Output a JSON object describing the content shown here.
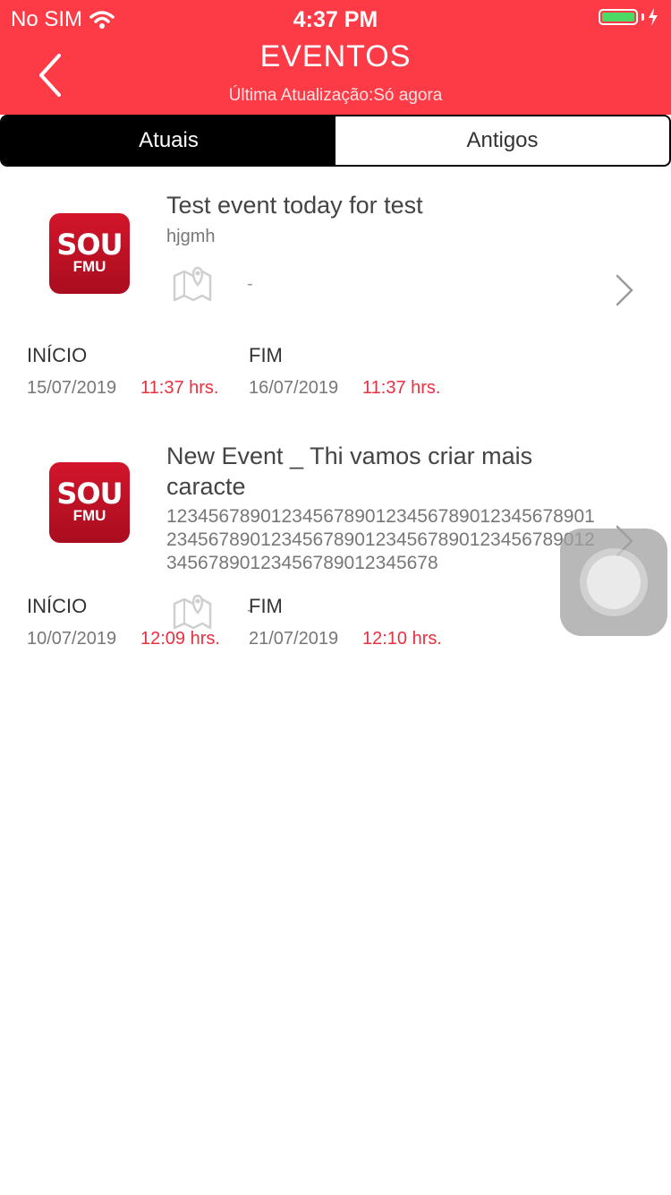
{
  "status_bar": {
    "carrier": "No SIM",
    "time": "4:37 PM",
    "battery_level": 1.0
  },
  "header": {
    "title": "EVENTOS",
    "subtitle": "Última Atualização:Só agora"
  },
  "tabs": [
    {
      "label": "Atuais",
      "active": true
    },
    {
      "label": "Antigos",
      "active": false
    }
  ],
  "logo": {
    "line1": "SOU",
    "line2": "FMU"
  },
  "labels": {
    "start": "INÍCIO",
    "end": "FIM"
  },
  "events": [
    {
      "title": "Test event today for test",
      "subtitle": "hjgmh",
      "location": "-",
      "start_date": "15/07/2019",
      "start_time": "11:37 hrs.",
      "end_date": "16/07/2019",
      "end_time": "11:37 hrs."
    },
    {
      "title": "New Event _ Thi vamos criar mais caracte",
      "description": "123456789012345678901234567890123456789012345678901234567890123456789012345678901234567890123456789012345678",
      "location": "-",
      "start_date": "10/07/2019",
      "start_time": "12:09 hrs.",
      "end_date": "21/07/2019",
      "end_time": "12:10 hrs."
    }
  ],
  "colors": {
    "header_bg": "#fc3b47",
    "time_text": "#ea3040",
    "battery": "#4cd964"
  }
}
